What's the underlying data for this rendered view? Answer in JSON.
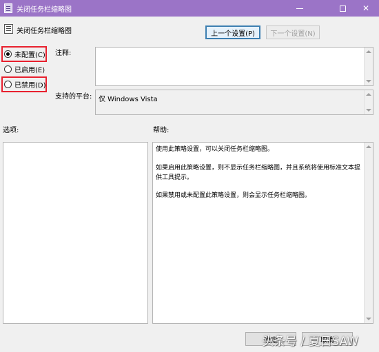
{
  "window": {
    "title": "关闭任务栏缩略图",
    "icons": {
      "app": "policy-icon",
      "minimize": "minimize-icon",
      "maximize": "maximize-icon",
      "close": "close-icon"
    }
  },
  "header": {
    "title": "关闭任务栏缩略图",
    "icon": "policy-icon"
  },
  "nav": {
    "prev_label": "上一个设置(P)",
    "next_label": "下一个设置(N)"
  },
  "state_options": [
    {
      "label": "未配置(C)",
      "checked": true
    },
    {
      "label": "已启用(E)",
      "checked": false
    },
    {
      "label": "已禁用(D)",
      "checked": false
    }
  ],
  "comment": {
    "label": "注释:",
    "value": ""
  },
  "platform": {
    "label": "支持的平台:",
    "value": "仅 Windows Vista"
  },
  "options": {
    "label": "选项:"
  },
  "help": {
    "label": "帮助:",
    "paragraphs": [
      "使用此策略设置，可以关闭任务栏缩略图。",
      "如果启用此策略设置，则不显示任务栏缩略图，并且系统将使用标准文本提供工具提示。",
      "如果禁用或未配置此策略设置，则会显示任务栏缩略图。"
    ]
  },
  "footer": {
    "ok_label": "确定",
    "cancel_label": "取消"
  },
  "watermark": "头条号 / 夏日SAW",
  "colors": {
    "titlebar": "#9b74c7",
    "highlight": "#e8202e",
    "focus": "#3c7fb1"
  }
}
